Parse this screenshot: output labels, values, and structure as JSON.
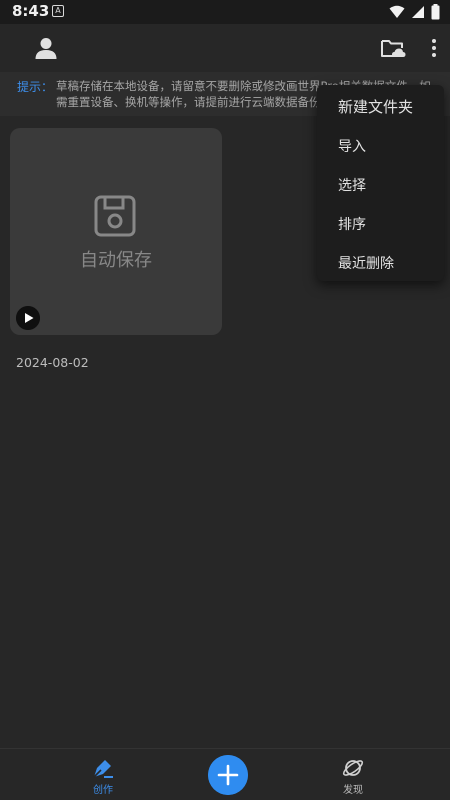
{
  "status_bar": {
    "time": "8:43",
    "notification_glyph": "A",
    "icons": [
      "wifi-icon",
      "signal-icon",
      "battery-icon"
    ]
  },
  "app_bar": {
    "icons": [
      "avatar-icon",
      "cloud-folder-icon",
      "more-vert-icon"
    ]
  },
  "tip": {
    "label": "提示：",
    "text": "草稿存储在本地设备，请留意不要删除或修改画世界Pro相关数据文件，如\n需重置设备、换机等操作，请提前进行云端数据备份"
  },
  "draft": {
    "title": "自动保存",
    "date": "2024-08-02",
    "icons": [
      "save-icon",
      "play-icon"
    ]
  },
  "menu": {
    "items": [
      "新建文件夹",
      "导入",
      "选择",
      "排序",
      "最近删除"
    ]
  },
  "bottom_nav": {
    "create_label": "创作",
    "discover_label": "发现",
    "icons": [
      "pen-icon",
      "add-icon",
      "planet-icon"
    ]
  },
  "colors": {
    "background": "#272727",
    "accent": "#2f8cf0",
    "menu_background": "#1d1d1d",
    "card_background": "#3a3a3a"
  }
}
